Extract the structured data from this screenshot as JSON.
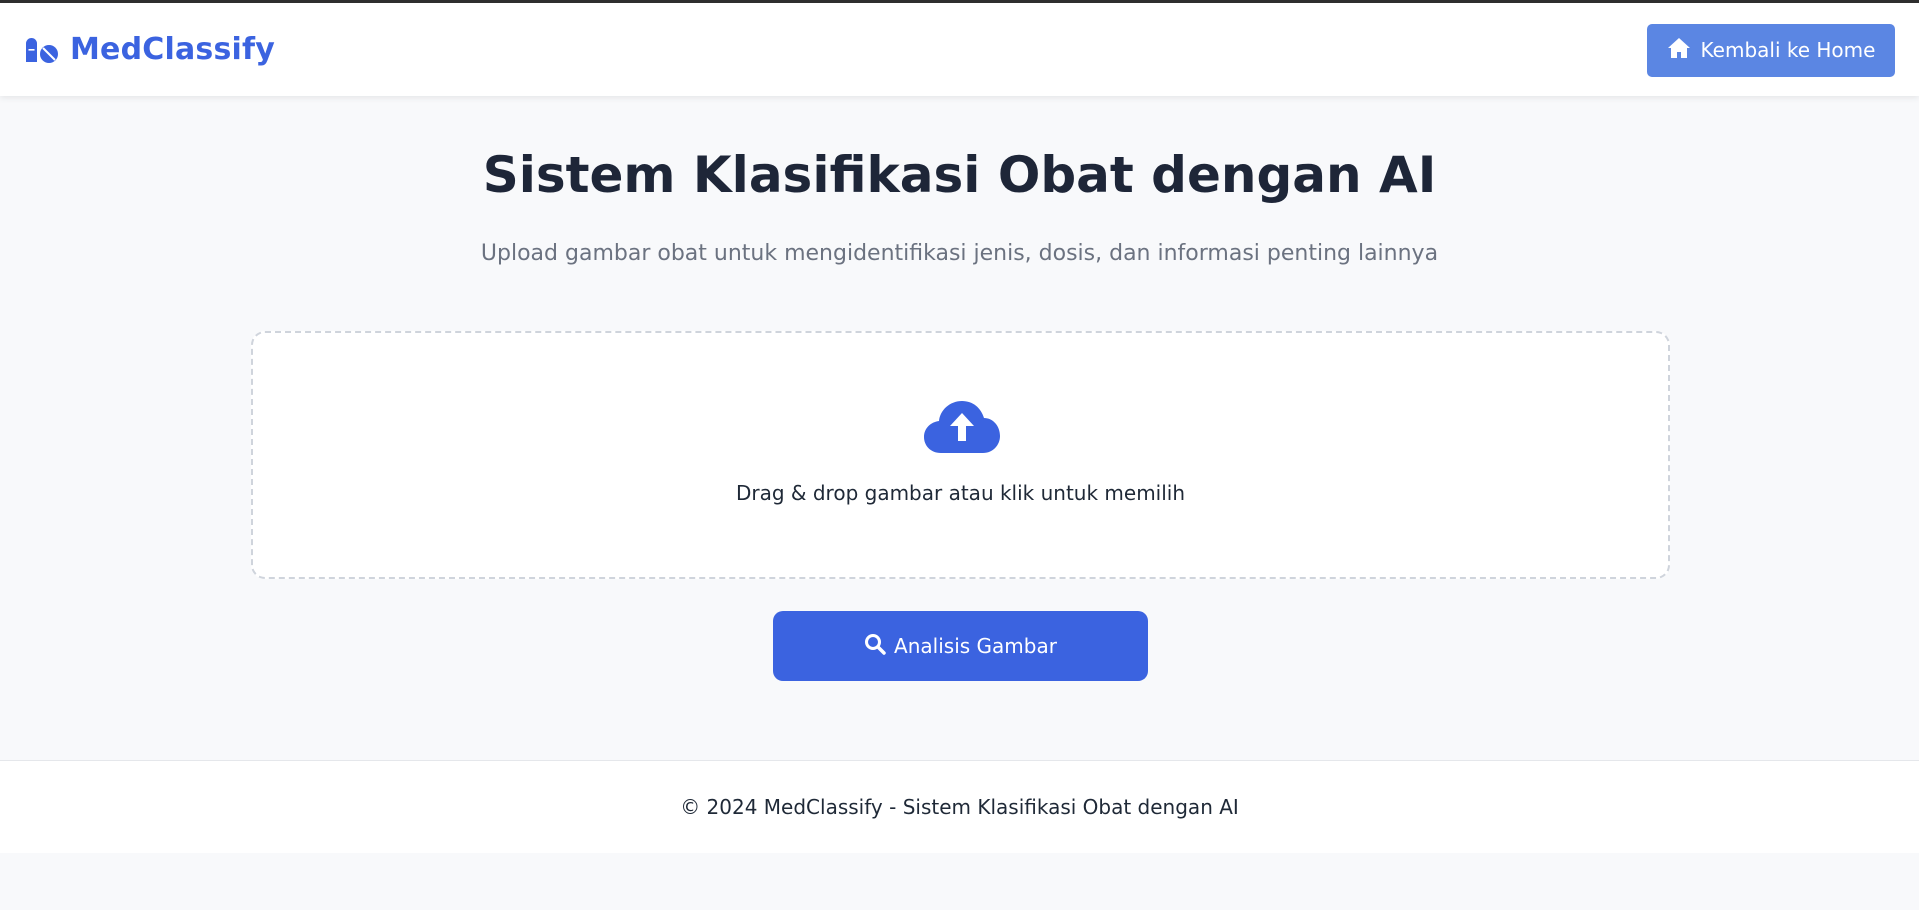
{
  "header": {
    "brand_name": "MedClassify",
    "brand_icon": "pills-icon",
    "home_button_label": "Kembali ke Home",
    "home_button_icon": "home-icon"
  },
  "main": {
    "title": "Sistem Klasifikasi Obat dengan AI",
    "subtitle": "Upload gambar obat untuk mengidentifikasi jenis, dosis, dan informasi penting lainnya",
    "upload": {
      "icon": "cloud-upload-icon",
      "instruction": "Drag & drop gambar atau klik untuk memilih"
    },
    "analyze_button_label": "Analisis Gambar",
    "analyze_button_icon": "search-icon"
  },
  "footer": {
    "text": "© 2024 MedClassify - Sistem Klasifikasi Obat dengan AI"
  },
  "colors": {
    "brand": "#3b63e0",
    "home_button": "#5b86e3",
    "analyze_button": "#3b63e0",
    "background": "#f8f9fb"
  }
}
